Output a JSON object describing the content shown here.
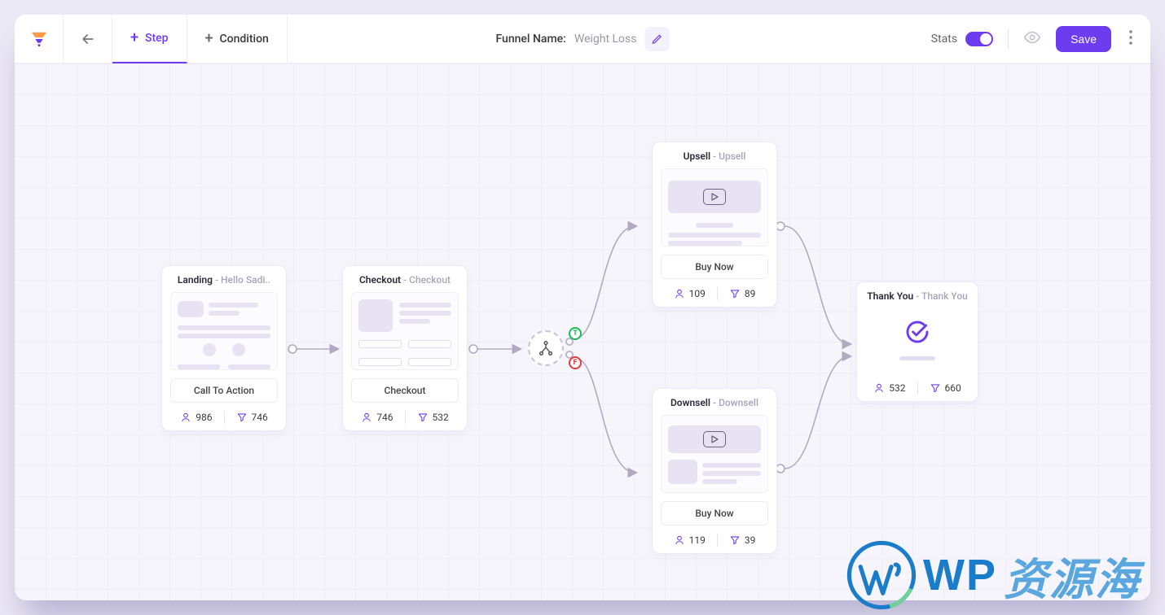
{
  "topbar": {
    "step_label": "Step",
    "condition_label": "Condition",
    "funnel_label": "Funnel Name:",
    "funnel_name": "Weight Loss",
    "stats_label": "Stats",
    "save_label": "Save"
  },
  "nodes": {
    "landing": {
      "type": "Landing",
      "name": "Hello Sadi..",
      "cta": "Call To Action",
      "visitors": "986",
      "conversions": "746"
    },
    "checkout": {
      "type": "Checkout",
      "name": "Checkout",
      "cta": "Checkout",
      "visitors": "746",
      "conversions": "532"
    },
    "upsell": {
      "type": "Upsell",
      "name": "Upsell",
      "cta": "Buy Now",
      "visitors": "109",
      "conversions": "89"
    },
    "downsell": {
      "type": "Downsell",
      "name": "Downsell",
      "cta": "Buy Now",
      "visitors": "119",
      "conversions": "39"
    },
    "thankyou": {
      "type": "Thank You",
      "name": "Thank You",
      "visitors": "532",
      "conversions": "660"
    }
  },
  "condition": {
    "true_badge": "T",
    "false_badge": "F"
  },
  "watermark": {
    "text1": "WP",
    "text2": "资源海"
  }
}
